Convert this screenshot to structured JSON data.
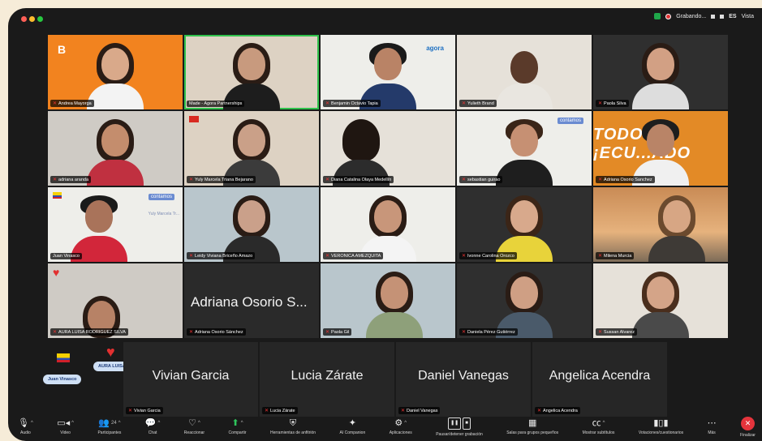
{
  "titlebar": {
    "recording_label": "Grabando...",
    "language": "ES",
    "view_label": "Vista"
  },
  "tiles": [
    {
      "name": "Andrea Mayorga"
    },
    {
      "name": "Made - Agora Partnerships"
    },
    {
      "name": "Benjamin Octavio Tapia"
    },
    {
      "name": "Yulieth Brand"
    },
    {
      "name": "Paola Silva"
    },
    {
      "name": "adriana aranda"
    },
    {
      "name": "Yuly Marcela Triana Bejarano"
    },
    {
      "name": "Diana Catalina Olaya Medellín"
    },
    {
      "name": "sebastian guirao"
    },
    {
      "name": "Adriana Osorio Sanchez"
    },
    {
      "name": "Juan Vinasco",
      "overlay_label": "Yuly Marcela Tr..."
    },
    {
      "name": "Leidy Viviana Briceño Amazo"
    },
    {
      "name": "VERONICA AMEZQUITA"
    },
    {
      "name": "Ivonne Carolina Orozco"
    },
    {
      "name": "Milena Murcia"
    },
    {
      "name": "AURA LUISA RODRIGUEZ SILVA"
    },
    {
      "name": "Adriana Osorio Sánchez",
      "display": "Adriana Osorio S..."
    },
    {
      "name": "Paola Gil"
    },
    {
      "name": "Daniela Pérez Gutiérrez"
    },
    {
      "name": "Sussan Alvarez"
    }
  ],
  "logos": {
    "b": "B",
    "agora": "agora",
    "contamos": "contamos",
    "banner": "TODO ¡ECU...ADO"
  },
  "floating": {
    "juan_pill": "Juan Vinasco",
    "aura_pill": "AURA LUISA RO"
  },
  "strip": [
    {
      "display": "Vivian Garcia",
      "name": "Vivian Garcia"
    },
    {
      "display": "Lucia Zárate",
      "name": "Lucia Zárate"
    },
    {
      "display": "Daniel Vanegas",
      "name": "Daniel Vanegas"
    },
    {
      "display": "Angelica Acendra",
      "name": "Angelica Acendra"
    }
  ],
  "toolbar": [
    {
      "label": "Audio",
      "icon": "mic-icon"
    },
    {
      "label": "Video",
      "icon": "video-icon"
    },
    {
      "label": "Participantes",
      "icon": "participants-icon",
      "count": "24"
    },
    {
      "label": "Chat",
      "icon": "chat-icon"
    },
    {
      "label": "Reaccionar",
      "icon": "heart-icon"
    },
    {
      "label": "Compartir",
      "icon": "share-icon"
    },
    {
      "label": "Herramientas de anfitrión",
      "icon": "shield-icon"
    },
    {
      "label": "AI Companion",
      "icon": "sparkle-icon"
    },
    {
      "label": "Aplicaciones",
      "icon": "apps-icon"
    },
    {
      "label": "Pausar/detener grabación",
      "icon": "record-controls-icon"
    },
    {
      "label": "Salas para grupos pequeños",
      "icon": "breakout-icon"
    },
    {
      "label": "Mostrar subtítulos",
      "icon": "cc-icon"
    },
    {
      "label": "Votaciones/cuestionarios",
      "icon": "poll-icon"
    },
    {
      "label": "Más",
      "icon": "more-icon"
    },
    {
      "label": "Finalizar",
      "icon": "end-icon"
    }
  ],
  "colors": {
    "window_bg": "#1a1a1a",
    "active_speaker": "#30c24c",
    "end_button": "#e5343c"
  }
}
